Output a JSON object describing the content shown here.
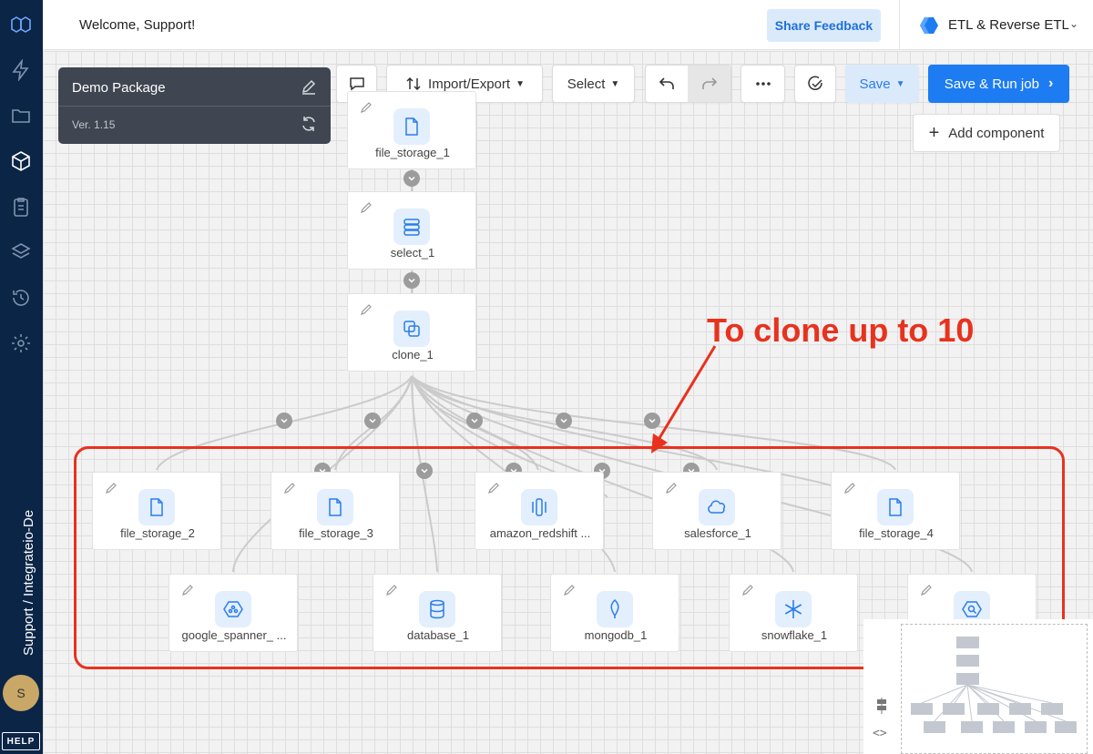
{
  "header": {
    "welcome": "Welcome, Support!",
    "share_feedback": "Share Feedback",
    "product": "ETL & Reverse ETL"
  },
  "sidebar": {
    "vertical_text": "Support / Integrateio-De",
    "avatar_initial": "S",
    "help_label": "HELP"
  },
  "package": {
    "name": "Demo Package",
    "version": "Ver. 1.15"
  },
  "toolbar": {
    "import_export": "Import/Export",
    "select": "Select",
    "save": "Save",
    "save_run": "Save & Run job",
    "add_component": "Add component"
  },
  "nodes": {
    "file_storage_1": "file_storage_1",
    "select_1": "select_1",
    "clone_1": "clone_1",
    "file_storage_2": "file_storage_2",
    "file_storage_3": "file_storage_3",
    "amazon_redshift": "amazon_redshift ...",
    "salesforce_1": "salesforce_1",
    "file_storage_4": "file_storage_4",
    "google_spanner": "google_spanner_ ...",
    "database_1": "database_1",
    "mongodb_1": "mongodb_1",
    "snowflake_1": "snowflake_1"
  },
  "annotation": "To clone up to 10",
  "colors": {
    "sidebar": "#0b2546",
    "primary": "#1d7cf2",
    "annotation": "#e8321e",
    "package_card": "#3f4651"
  }
}
